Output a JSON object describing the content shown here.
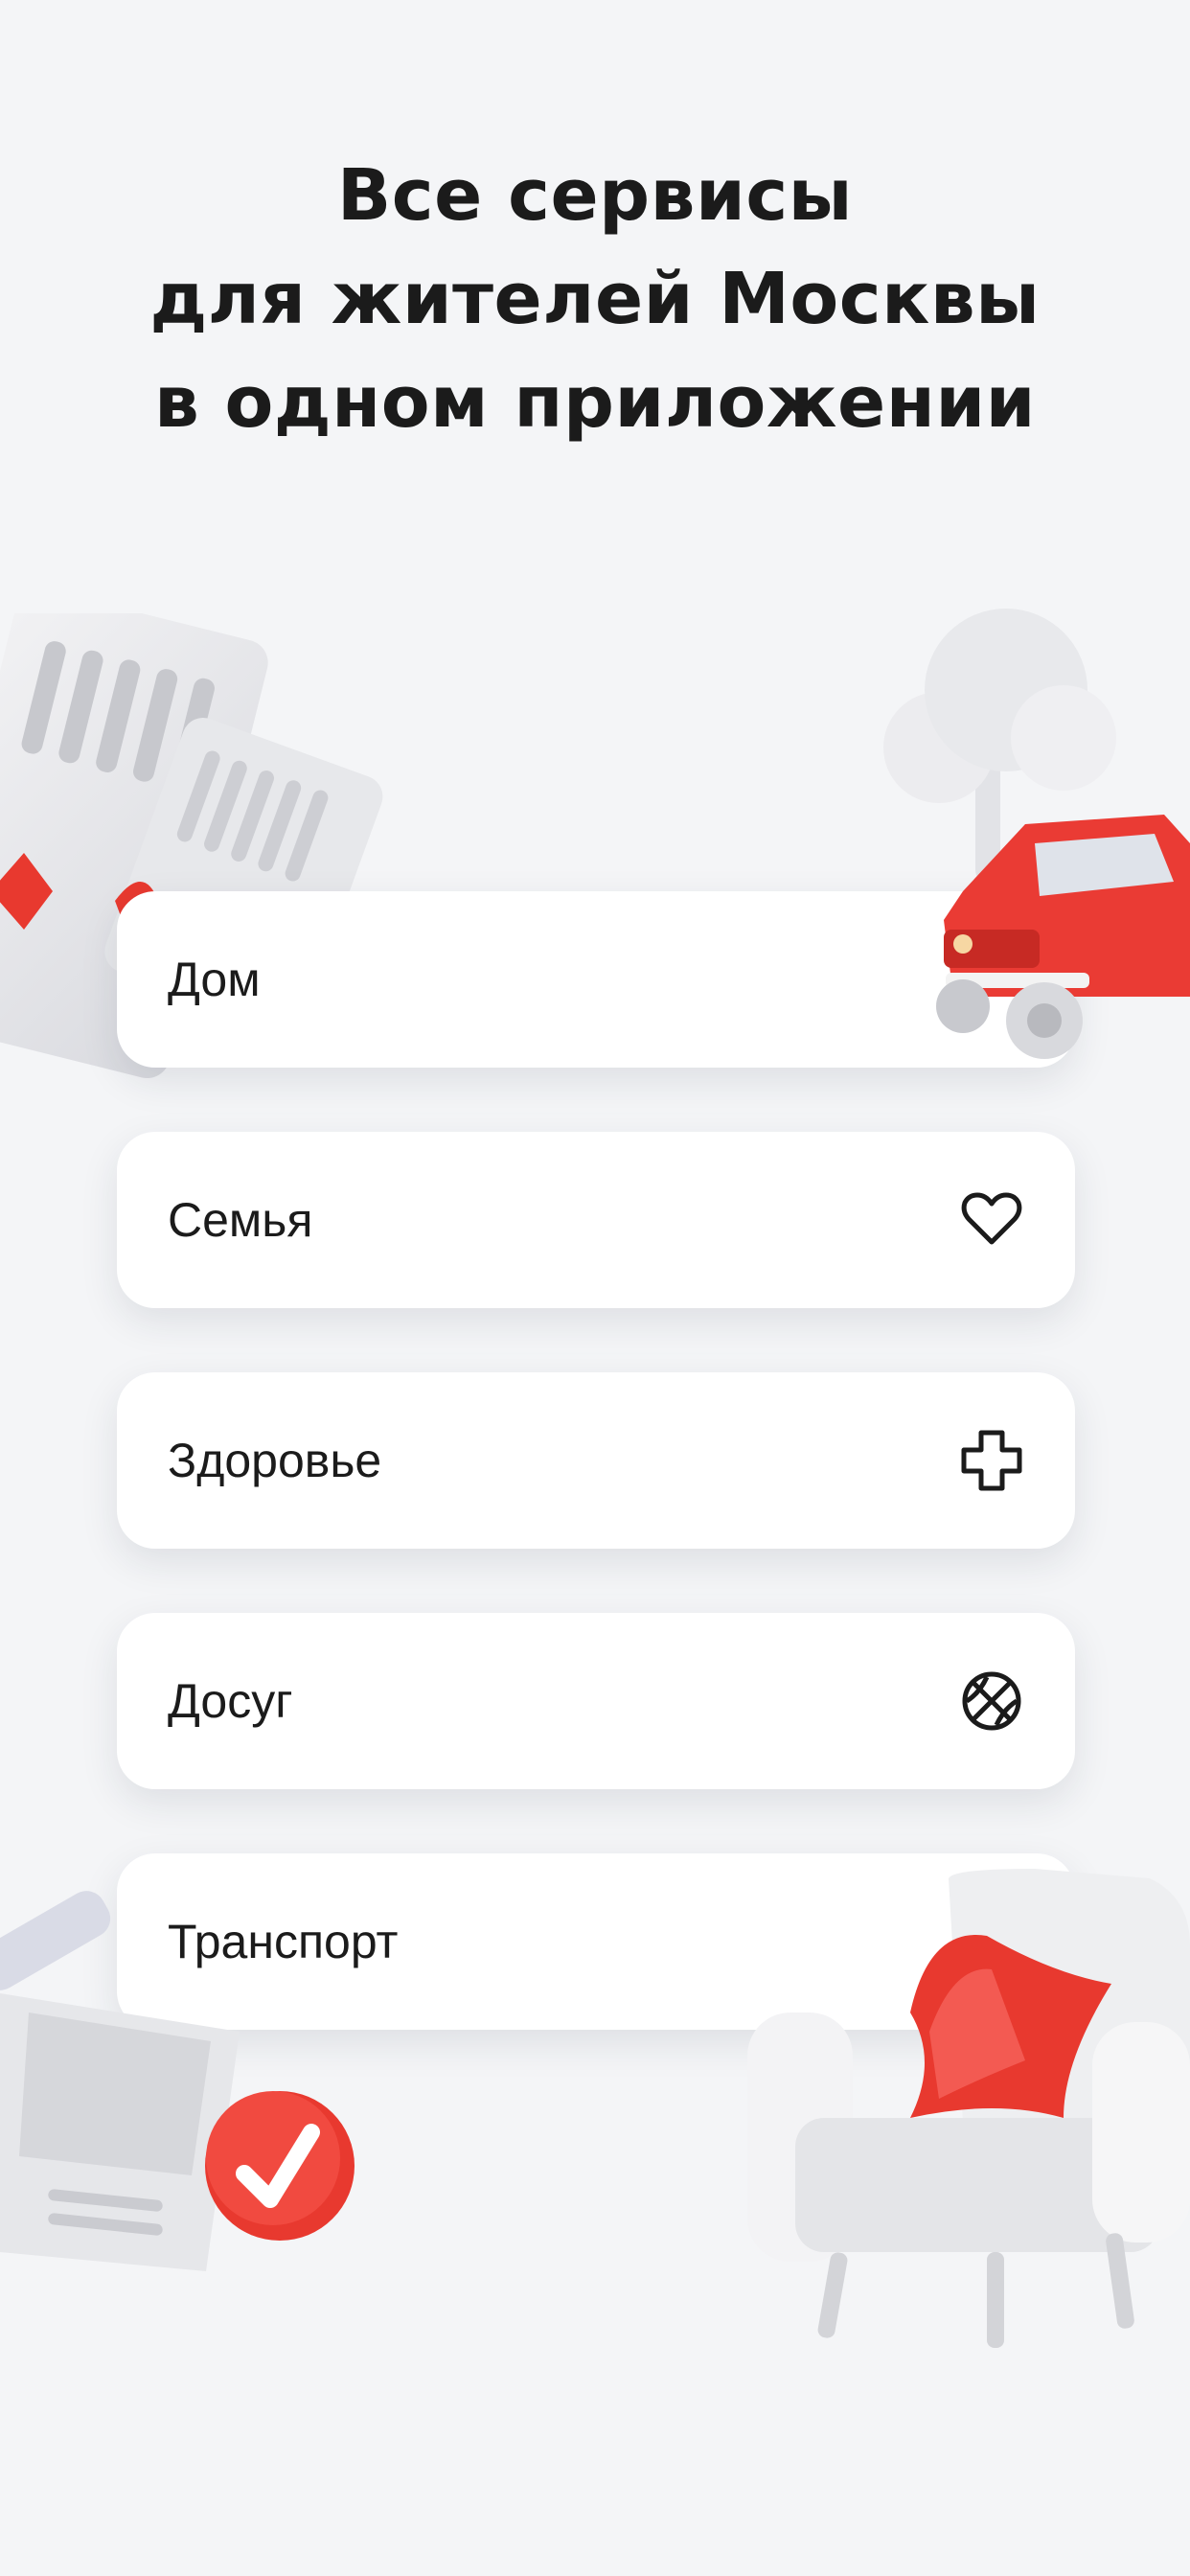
{
  "headline": {
    "line1": "Все сервисы",
    "line2": "для жителей Москвы",
    "line3": "в одном приложении"
  },
  "services": [
    {
      "label": "Дом",
      "icon": "house-icon"
    },
    {
      "label": "Семья",
      "icon": "heart-icon"
    },
    {
      "label": "Здоровье",
      "icon": "medical-cross-icon"
    },
    {
      "label": "Досуг",
      "icon": "basketball-icon"
    },
    {
      "label": "Транспорт",
      "icon": "car-icon"
    }
  ],
  "colors": {
    "background": "#f4f5f7",
    "card": "#ffffff",
    "text": "#1b1b1b",
    "accent_red": "#e8392f"
  },
  "decorations": [
    "documents-illustration",
    "tree-illustration",
    "red-car-illustration",
    "paper-with-checkmark-illustration",
    "armchair-with-pillow-illustration"
  ]
}
